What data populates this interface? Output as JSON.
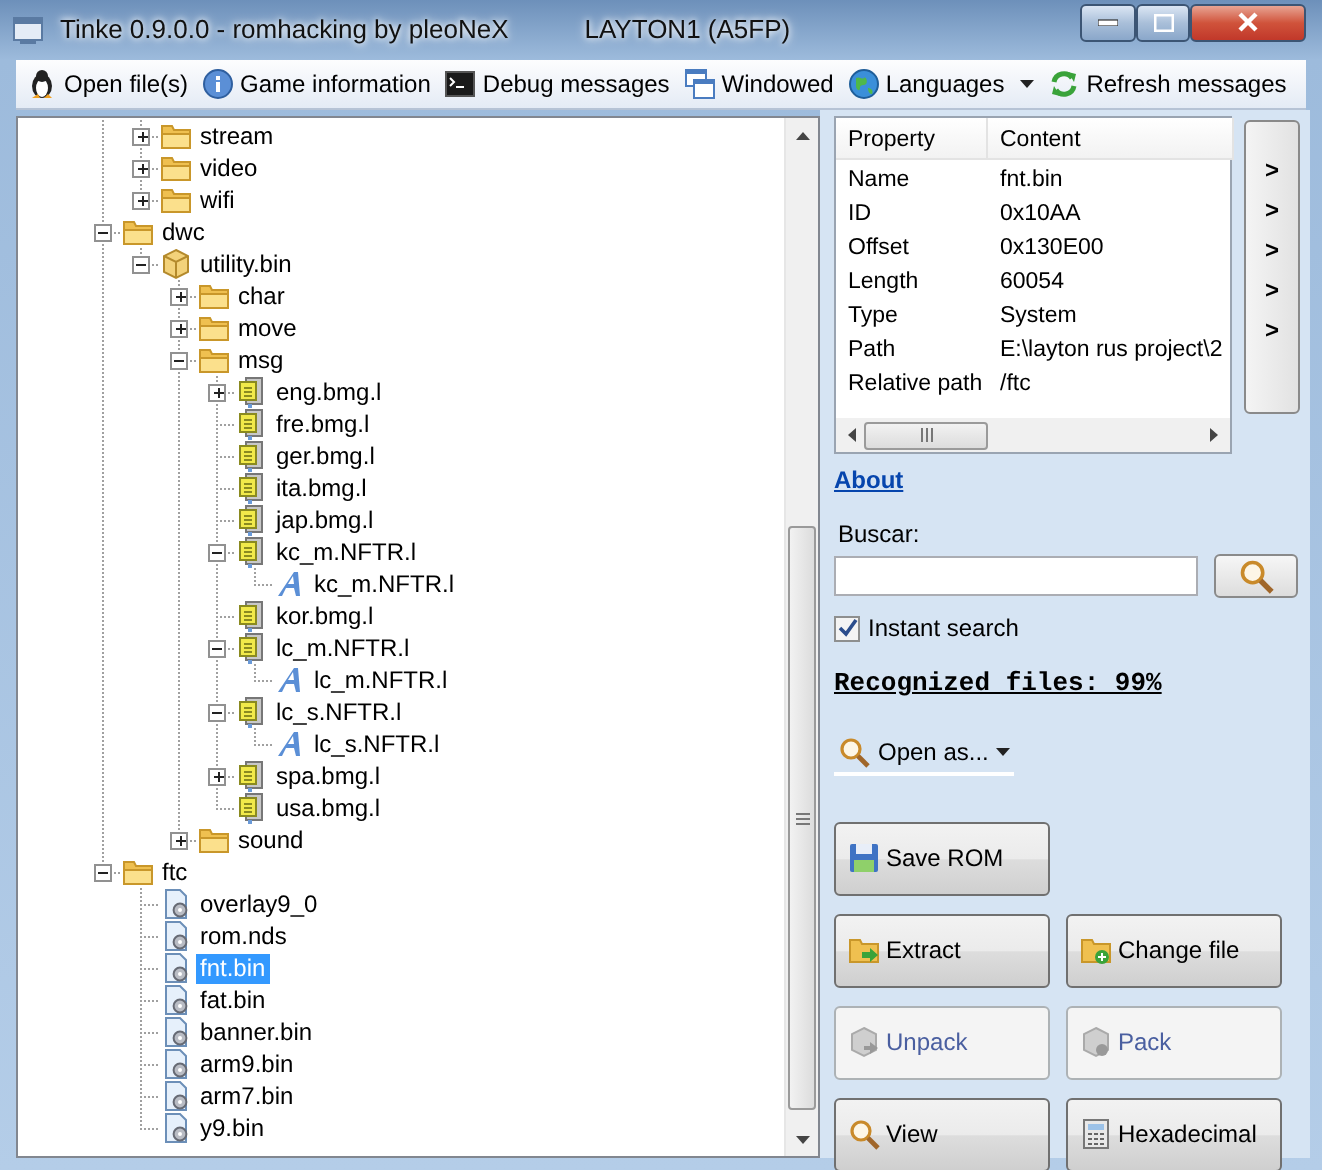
{
  "window": {
    "title": "Tinke 0.9.0.0 - romhacking by pleoNeX",
    "subtitle": "LAYTON1 (A5FP)"
  },
  "toolbar": [
    {
      "label": "Open file(s)",
      "dropdown": false
    },
    {
      "label": "Game information",
      "dropdown": false
    },
    {
      "label": "Debug messages",
      "dropdown": false
    },
    {
      "label": "Windowed",
      "dropdown": false
    },
    {
      "label": "Languages",
      "dropdown": true
    },
    {
      "label": "Refresh messages",
      "dropdown": false
    }
  ],
  "tree": {
    "items": [
      {
        "children": [
          {
            "label": "stream",
            "kind": "folder",
            "expanded": false,
            "selected": false
          },
          {
            "label": "video",
            "kind": "folder",
            "expanded": false,
            "selected": false
          },
          {
            "label": "wifi",
            "kind": "folder",
            "expanded": false,
            "selected": false
          }
        ]
      },
      {
        "label": "dwc",
        "kind": "folder",
        "expanded": true,
        "selected": false,
        "children": [
          {
            "label": "utility.bin",
            "kind": "package",
            "expanded": true,
            "selected": false,
            "children": [
              {
                "label": "char",
                "kind": "folder",
                "expanded": false,
                "selected": false
              },
              {
                "label": "move",
                "kind": "folder",
                "expanded": false,
                "selected": false
              },
              {
                "label": "msg",
                "kind": "folder",
                "expanded": true,
                "selected": false,
                "children": [
                  {
                    "label": "eng.bmg.l",
                    "kind": "bmg",
                    "expanded": false,
                    "selected": false
                  },
                  {
                    "label": "fre.bmg.l",
                    "kind": "bmg",
                    "selected": false
                  },
                  {
                    "label": "ger.bmg.l",
                    "kind": "bmg",
                    "selected": false
                  },
                  {
                    "label": "ita.bmg.l",
                    "kind": "bmg",
                    "selected": false
                  },
                  {
                    "label": "jap.bmg.l",
                    "kind": "bmg",
                    "selected": false
                  },
                  {
                    "label": "kc_m.NFTR.l",
                    "kind": "bmg",
                    "expanded": true,
                    "selected": false,
                    "children": [
                      {
                        "label": "kc_m.NFTR.l",
                        "kind": "font",
                        "selected": false
                      }
                    ]
                  },
                  {
                    "label": "kor.bmg.l",
                    "kind": "bmg",
                    "selected": false
                  },
                  {
                    "label": "lc_m.NFTR.l",
                    "kind": "bmg",
                    "expanded": true,
                    "selected": false,
                    "children": [
                      {
                        "label": "lc_m.NFTR.l",
                        "kind": "font",
                        "selected": false
                      }
                    ]
                  },
                  {
                    "label": "lc_s.NFTR.l",
                    "kind": "bmg",
                    "expanded": true,
                    "selected": false,
                    "children": [
                      {
                        "label": "lc_s.NFTR.l",
                        "kind": "font",
                        "selected": false
                      }
                    ]
                  },
                  {
                    "label": "spa.bmg.l",
                    "kind": "bmg",
                    "expanded": false,
                    "selected": false
                  },
                  {
                    "label": "usa.bmg.l",
                    "kind": "bmg",
                    "selected": false
                  }
                ]
              },
              {
                "label": "sound",
                "kind": "folder",
                "expanded": false,
                "selected": false
              }
            ]
          }
        ]
      },
      {
        "label": "ftc",
        "kind": "folder",
        "expanded": true,
        "selected": false,
        "children": [
          {
            "label": "overlay9_0",
            "kind": "file",
            "selected": false
          },
          {
            "label": "rom.nds",
            "kind": "file",
            "selected": false
          },
          {
            "label": "fnt.bin",
            "kind": "file",
            "selected": true
          },
          {
            "label": "fat.bin",
            "kind": "file",
            "selected": false
          },
          {
            "label": "banner.bin",
            "kind": "file",
            "selected": false
          },
          {
            "label": "arm9.bin",
            "kind": "file",
            "selected": false
          },
          {
            "label": "arm7.bin",
            "kind": "file",
            "selected": false
          },
          {
            "label": "y9.bin",
            "kind": "file",
            "selected": false
          }
        ]
      }
    ]
  },
  "properties": {
    "columns": [
      "Property",
      "Content"
    ],
    "rows": [
      [
        "Name",
        "fnt.bin"
      ],
      [
        "ID",
        "0x10AA"
      ],
      [
        "Offset",
        "0x130E00"
      ],
      [
        "Length",
        "60054"
      ],
      [
        "Type",
        "System"
      ],
      [
        "Path",
        "E:\\layton rus project\\2"
      ],
      [
        "Relative path",
        "/ftc"
      ]
    ]
  },
  "side_arrows": [
    ">",
    ">",
    ">",
    ">",
    ">"
  ],
  "about_link": "About",
  "search": {
    "label": "Buscar:"
  },
  "instant_search": {
    "label": "Instant search",
    "checked": true
  },
  "recognized": "Recognized files: 99%",
  "open_as": {
    "label": "Open as..."
  },
  "button_rows": [
    [
      {
        "label": "Save ROM",
        "disabled": false
      }
    ],
    [
      {
        "label": "Extract",
        "disabled": false
      },
      {
        "label": "Change file",
        "disabled": false
      }
    ],
    [
      {
        "label": "Unpack",
        "disabled": true
      },
      {
        "label": "Pack",
        "disabled": true
      }
    ],
    [
      {
        "label": "View",
        "disabled": false
      },
      {
        "label": "Hexadecimal",
        "disabled": false
      }
    ]
  ]
}
